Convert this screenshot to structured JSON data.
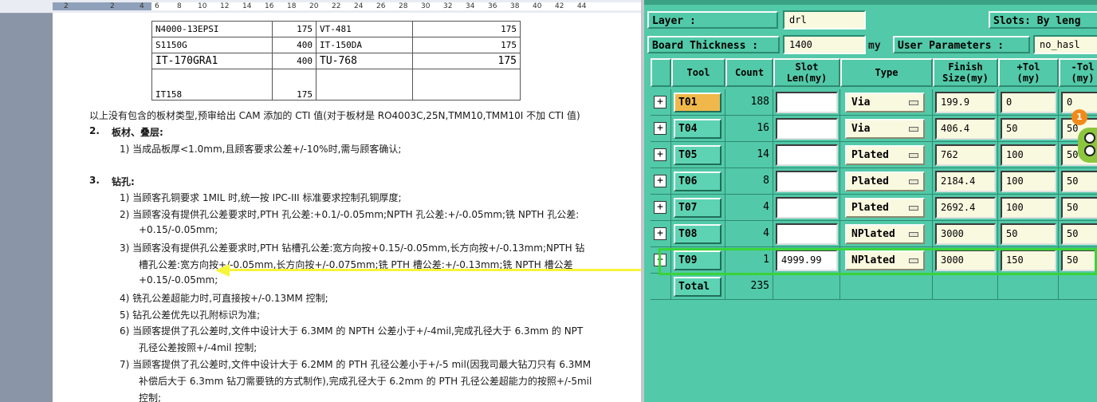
{
  "ruler": {
    "ticks": [
      "2",
      "2",
      "4",
      "6",
      "8",
      "10",
      "12",
      "14",
      "16",
      "18",
      "20",
      "22",
      "24",
      "26",
      "28",
      "30",
      "32",
      "34",
      "36",
      "38",
      "40",
      "42",
      "44"
    ]
  },
  "board_table": {
    "rows": [
      [
        "N4000-13EPSI",
        "175",
        "VT-481",
        "175"
      ],
      [
        "S1150G",
        "400",
        "IT-150DA",
        "175"
      ],
      [
        "IT-170GRA1",
        "400",
        "TU-768",
        "175"
      ],
      [
        "IT158",
        "175",
        "",
        ""
      ]
    ]
  },
  "doc": {
    "line_intro": "以上没有包含的板材类型,预审给出 CAM 添加的 CTI 值(对于板材是 RO4003C,25N,TMM10,TMM10I 不加 CTI 值)",
    "sec2_num": "2.",
    "sec2_title": "板材、叠层:",
    "sec2_item1": "1)  当成品板厚<1.0mm,且顾客要求公差+/-10%时,需与顾客确认;",
    "sec3_num": "3.",
    "sec3_title": "钻孔:",
    "sec3_item1": "1)  当顾客孔铜要求 1MIL 时,统一按 IPC-III 标准要求控制孔铜厚度;",
    "sec3_item2a": "2)  当顾客没有提供孔公差要求时,PTH 孔公差:+0.1/-0.05mm;NPTH 孔公差:+/-0.05mm;铣 NPTH 孔公差:",
    "sec3_item2b": "+0.15/-0.05mm;",
    "sec3_item3a": "3)  当顾客没有提供孔公差要求时,PTH 钻槽孔公差:宽方向按+0.15/-0.05mm,长方向按+/-0.13mm;NPTH 钻",
    "sec3_item3b": "槽孔公差:宽方向按+/-0.05mm,长方向按+/-0.075mm;铣 PTH 槽公差:+/-0.13mm;铣 NPTH 槽公差",
    "sec3_item3c": "+0.15/-0.05mm;",
    "sec3_item4": "4)  铣孔公差超能力时,可直接按+/-0.13MM 控制;",
    "sec3_item5": "5)  钻孔公差优先以孔附标识为准;",
    "sec3_item6a": "6)  当顾客提供了孔公差时,文件中设计大于 6.3MM 的 NPTH 公差小于+/-4mil,完成孔径大于 6.3mm 的 NPT",
    "sec3_item6b": "孔径公差按照+/-4mil 控制;",
    "sec3_item7a": "7)  当顾客提供了孔公差时,文件中设计大于 6.2MM 的 PTH 孔径公差小于+/-5 mil(因我司最大钻刀只有 6.3MM",
    "sec3_item7b": "补偿后大于 6.3mm 钻刀需要铣的方式制作),完成孔径大于 6.2mm 的 PTH 孔径公差超能力的按照+/-5mil",
    "sec3_item7c": "控制;"
  },
  "cam": {
    "layer_label": "Layer         :",
    "layer_value": "drl",
    "slots_label": "Slots: By leng",
    "thickness_label": "Board Thickness :",
    "thickness_value": "1400",
    "thickness_unit": "my",
    "userparam_label": "User Parameters :",
    "userparam_value": "no_hasl",
    "headers": {
      "tool": "Tool",
      "count": "Count",
      "slot": "Slot\nLen(my)",
      "type": "Type",
      "finish": "Finish\nSize(my)",
      "ptol": "+Tol\n(my)",
      "mtol": "-Tol\n(my)"
    },
    "rows": [
      {
        "tool": "T01",
        "count": "188",
        "slot": "",
        "type": "Via",
        "finish": "199.9",
        "ptol": "0",
        "mtol": "0"
      },
      {
        "tool": "T04",
        "count": "16",
        "slot": "",
        "type": "Via",
        "finish": "406.4",
        "ptol": "50",
        "mtol": "50"
      },
      {
        "tool": "T05",
        "count": "14",
        "slot": "",
        "type": "Plated",
        "finish": "762",
        "ptol": "100",
        "mtol": "50"
      },
      {
        "tool": "T06",
        "count": "8",
        "slot": "",
        "type": "Plated",
        "finish": "2184.4",
        "ptol": "100",
        "mtol": "50"
      },
      {
        "tool": "T07",
        "count": "4",
        "slot": "",
        "type": "Plated",
        "finish": "2692.4",
        "ptol": "100",
        "mtol": "50"
      },
      {
        "tool": "T08",
        "count": "4",
        "slot": "",
        "type": "NPlated",
        "finish": "3000",
        "ptol": "50",
        "mtol": "50"
      },
      {
        "tool": "T09",
        "count": "1",
        "slot": "4999.99",
        "type": "NPlated",
        "finish": "3000",
        "ptol": "150",
        "mtol": "50"
      }
    ],
    "total_label": "Total",
    "total_value": "235",
    "notification_count": "1",
    "colors": {
      "panel": "#52c9a8",
      "selected_tool": "#f0b84a",
      "highlight": "#39d43a",
      "arrow": "#f7f53a"
    }
  }
}
